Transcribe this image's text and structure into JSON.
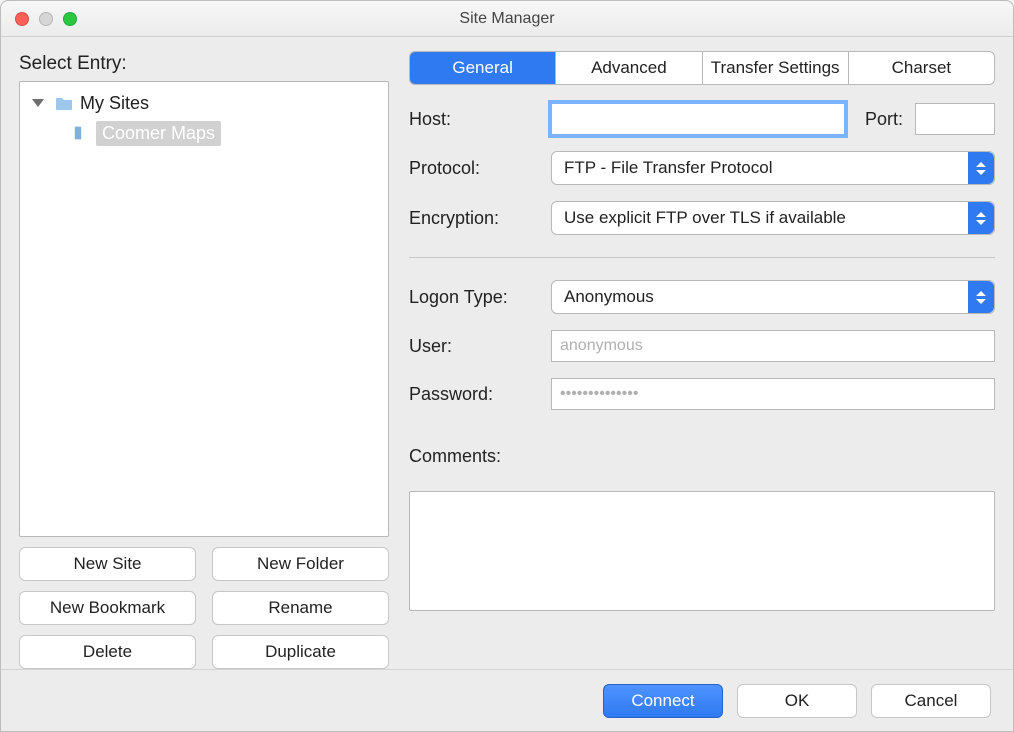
{
  "window": {
    "title": "Site Manager"
  },
  "left": {
    "heading": "Select Entry:",
    "tree": {
      "root_label": "My Sites",
      "items": [
        {
          "label": "Coomer Maps",
          "selected": true
        }
      ]
    },
    "buttons": {
      "new_site": "New Site",
      "new_folder": "New Folder",
      "new_bookmark": "New Bookmark",
      "rename": "Rename",
      "delete": "Delete",
      "duplicate": "Duplicate"
    }
  },
  "tabs": {
    "general": "General",
    "advanced": "Advanced",
    "transfer": "Transfer Settings",
    "charset": "Charset",
    "active": "general"
  },
  "general": {
    "host_label": "Host:",
    "host_value": "",
    "port_label": "Port:",
    "port_value": "",
    "protocol_label": "Protocol:",
    "protocol_value": "FTP - File Transfer Protocol",
    "encryption_label": "Encryption:",
    "encryption_value": "Use explicit FTP over TLS if available",
    "logon_type_label": "Logon Type:",
    "logon_type_value": "Anonymous",
    "user_label": "User:",
    "user_placeholder": "anonymous",
    "user_value": "",
    "password_label": "Password:",
    "password_placeholder": "••••••••••••••",
    "password_value": "",
    "comments_label": "Comments:",
    "comments_value": ""
  },
  "footer": {
    "connect": "Connect",
    "ok": "OK",
    "cancel": "Cancel"
  }
}
